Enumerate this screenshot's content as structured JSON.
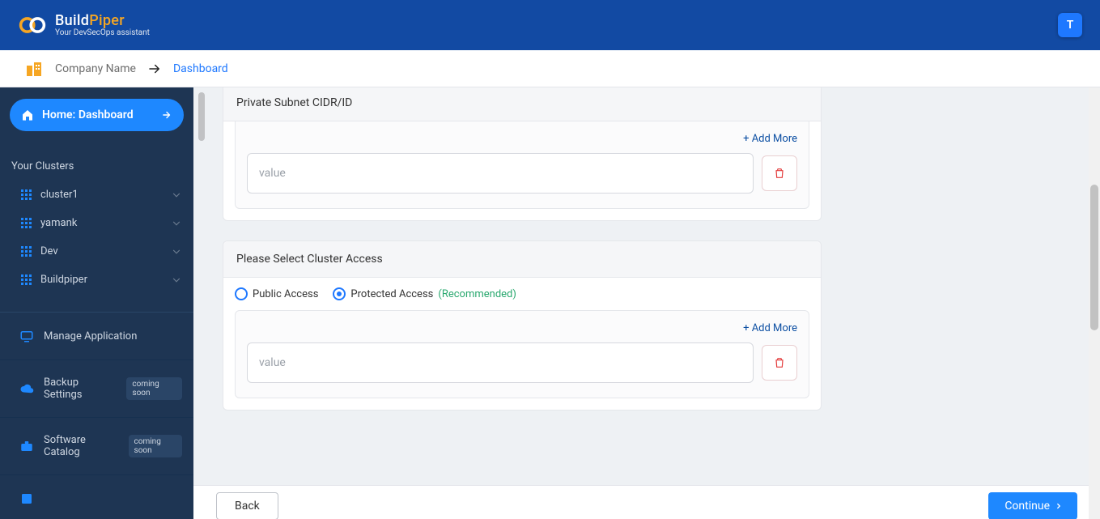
{
  "brand": {
    "name_a": "Build",
    "name_b": "Piper",
    "tagline": "Your DevSecOps assistant"
  },
  "avatar": {
    "initial": "T"
  },
  "breadcrumb": {
    "company": "Company Name",
    "link": "Dashboard"
  },
  "sidebar": {
    "home_label": "Home: Dashboard",
    "clusters_title": "Your Clusters",
    "clusters": [
      {
        "label": "cluster1"
      },
      {
        "label": "yamank"
      },
      {
        "label": "Dev"
      },
      {
        "label": "Buildpiper"
      }
    ],
    "manage_app": "Manage Application",
    "backup": {
      "label": "Backup Settings",
      "badge": "coming soon"
    },
    "catalog": {
      "label": "Software Catalog",
      "badge": "coming soon"
    }
  },
  "form": {
    "subnet_title": "Private Subnet CIDR/ID",
    "add_more": "Add More",
    "value_placeholder": "value",
    "access_title": "Please Select Cluster Access",
    "radios": {
      "public": "Public Access",
      "protected": "Protected Access",
      "recommended": "(Recommended)"
    },
    "back": "Back",
    "continue": "Continue"
  }
}
